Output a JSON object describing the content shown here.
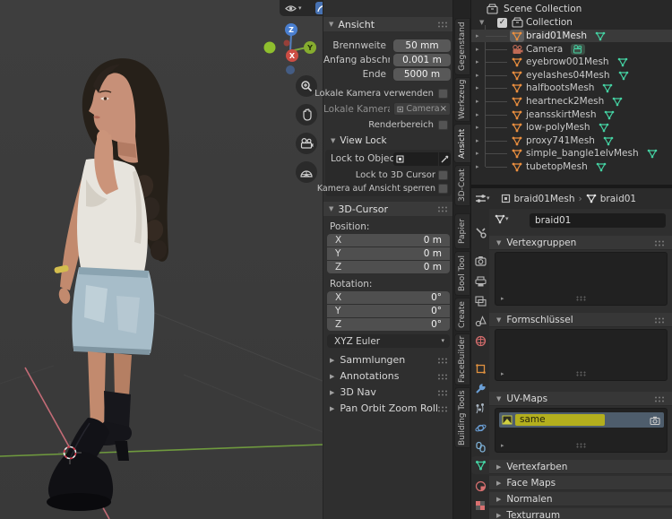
{
  "icons": {
    "tri_down": "▼",
    "tri_right": "▶",
    "tri_right_sm": "▸",
    "chev_down": "▾",
    "crumb_sep": "›",
    "close": "×",
    "check": "✓"
  },
  "viewport_header": {
    "buttons": [
      "visibility-dropdown",
      "snap-dropdown",
      "gizmos-dropdown",
      "xray-toggle",
      "shading-wireframe",
      "shading-solid",
      "shading-material",
      "shading-rendered"
    ]
  },
  "gizmo": {
    "x": "X",
    "y": "Y",
    "z": "Z"
  },
  "nav_buttons": [
    "zoom",
    "pan",
    "camera-view",
    "toggle-projection"
  ],
  "npanel": {
    "ansicht": {
      "title": "Ansicht",
      "fields": [
        {
          "label": "Brennweite",
          "value": "50 mm"
        },
        {
          "label": "Anfang abschne..",
          "value": "0.001 m"
        },
        {
          "label": "Ende",
          "value": "5000 m"
        }
      ],
      "local_camera_toggle": "Lokale Kamera verwenden",
      "local_camera_label": "Lokale Kamera",
      "local_camera_value": "Camera",
      "render_region": "Renderbereich"
    },
    "view_lock": {
      "title": "View Lock",
      "lock_to_object": "Lock to Object",
      "lock_to_3d_cursor": "Lock to 3D Cursor",
      "lock_camera": "Kamera auf Ansicht sperren"
    },
    "cursor": {
      "title": "3D-Cursor",
      "position_label": "Position:",
      "rotation_label": "Rotation:",
      "position": [
        {
          "axis": "X",
          "value": "0 m"
        },
        {
          "axis": "Y",
          "value": "0 m"
        },
        {
          "axis": "Z",
          "value": "0 m"
        }
      ],
      "rotation": [
        {
          "axis": "X",
          "value": "0°"
        },
        {
          "axis": "Y",
          "value": "0°"
        },
        {
          "axis": "Z",
          "value": "0°"
        }
      ],
      "euler_mode": "XYZ Euler"
    },
    "collapsed": [
      "Sammlungen",
      "Annotations",
      "3D Nav",
      "Pan Orbit Zoom Roll"
    ]
  },
  "tabs": [
    "Gegenstand",
    "Werkzeug",
    "Ansicht",
    "3D-Coat",
    "Papier",
    "Bool Tool",
    "Create",
    "FaceBuilder",
    "Building Tools"
  ],
  "active_tab": "Ansicht",
  "outliner": {
    "scene_collection": "Scene Collection",
    "collection": "Collection",
    "items": [
      {
        "name": "braid01Mesh",
        "type": "mesh",
        "selected": true
      },
      {
        "name": "Camera",
        "type": "camera",
        "selected": false
      },
      {
        "name": "eyebrow001Mesh",
        "type": "mesh",
        "selected": false
      },
      {
        "name": "eyelashes04Mesh",
        "type": "mesh",
        "selected": false
      },
      {
        "name": "halfbootsMesh",
        "type": "mesh",
        "selected": false
      },
      {
        "name": "heartneck2Mesh",
        "type": "mesh",
        "selected": false
      },
      {
        "name": "jeansskirtMesh",
        "type": "mesh",
        "selected": false
      },
      {
        "name": "low-polyMesh",
        "type": "mesh",
        "selected": false
      },
      {
        "name": "proxy741Mesh",
        "type": "mesh",
        "selected": false
      },
      {
        "name": "simple_bangle1elvMesh",
        "type": "mesh",
        "selected": false
      },
      {
        "name": "tubetopMesh",
        "type": "mesh",
        "selected": false
      }
    ]
  },
  "properties": {
    "breadcrumb": {
      "object": "braid01Mesh",
      "data": "braid01"
    },
    "name_value": "braid01",
    "tab_icons": [
      "tool-icon",
      "render-icon",
      "output-icon",
      "view-layer-icon",
      "scene-icon",
      "world-icon",
      "object-icon",
      "modifiers-icon",
      "particles-icon",
      "physics-icon",
      "constraints-icon",
      "object-data-icon",
      "material-icon",
      "texture-icon"
    ],
    "active_tab_icon": "object-data-icon",
    "sections": {
      "vertex_groups": "Vertexgruppen",
      "shape_keys": "Formschlüssel",
      "uv_maps": "UV-Maps"
    },
    "uv_map_entry": "same",
    "collapsed_sections": [
      "Vertexfarben",
      "Face Maps",
      "Normalen",
      "Texturraum"
    ]
  },
  "colors": {
    "accent_blue": "#4772b3",
    "mesh_orange": "#eb8f3f",
    "data_green": "#44d1a2",
    "highlight_yellow": "#b3af1e",
    "axis_x": "#c36b76",
    "axis_y": "#6f9a3e",
    "axis_z": "#4a7fd0"
  }
}
